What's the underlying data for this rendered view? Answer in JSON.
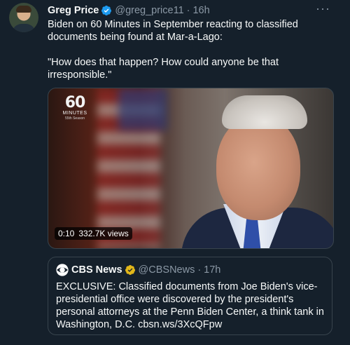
{
  "tweet": {
    "author_name": "Greg Price",
    "author_handle": "@greg_price11",
    "separator": "·",
    "time": "16h",
    "more_label": "···",
    "text_line1": "Biden on 60 Minutes in September reacting to classified documents being found at Mar-a-Lago:",
    "text_line2": "\"How does that happen? How could anyone be that irresponsible.\""
  },
  "video": {
    "logo_number": "60",
    "logo_word": "MINUTES",
    "logo_season": "55th Season",
    "duration": "0:10",
    "views": "332.7K views"
  },
  "quote": {
    "author_name": "CBS News",
    "author_handle": "@CBSNews",
    "separator": "·",
    "time": "17h",
    "text": "EXCLUSIVE: Classified documents from Joe Biden's vice-presidential office were discovered by the president's personal attorneys at the Penn Biden Center, a think tank in Washington, D.C. cbsn.ws/3XcQFpw"
  },
  "colors": {
    "background": "#15202b",
    "verified_blue": "#1d9bf0",
    "verified_gold": "#e2b719",
    "muted_text": "#8b98a5",
    "border": "#38444d"
  },
  "icons": {
    "verified": "verified-badge-icon",
    "verified_gold": "verified-gold-badge-icon",
    "more": "more-horizontal-icon",
    "cbs": "cbs-eye-logo-icon"
  }
}
